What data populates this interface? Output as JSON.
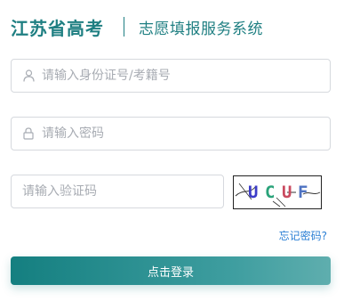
{
  "header": {
    "brand": "江苏省高考",
    "subtitle": "志愿填报服务系统"
  },
  "form": {
    "id_field": {
      "placeholder": "请输入身份证号/考籍号",
      "value": "",
      "icon": "user-icon"
    },
    "password_field": {
      "placeholder": "请输入密码",
      "value": "",
      "icon": "lock-icon"
    },
    "captcha_field": {
      "placeholder": "请输入验证码",
      "value": ""
    },
    "captcha_text": "UCUF",
    "forgot_label": "忘记密码?",
    "login_label": "点击登录"
  },
  "colors": {
    "brand": "#1f7f82",
    "link": "#2b7fd4",
    "button_start": "#147f80",
    "button_end": "#5faeae"
  }
}
